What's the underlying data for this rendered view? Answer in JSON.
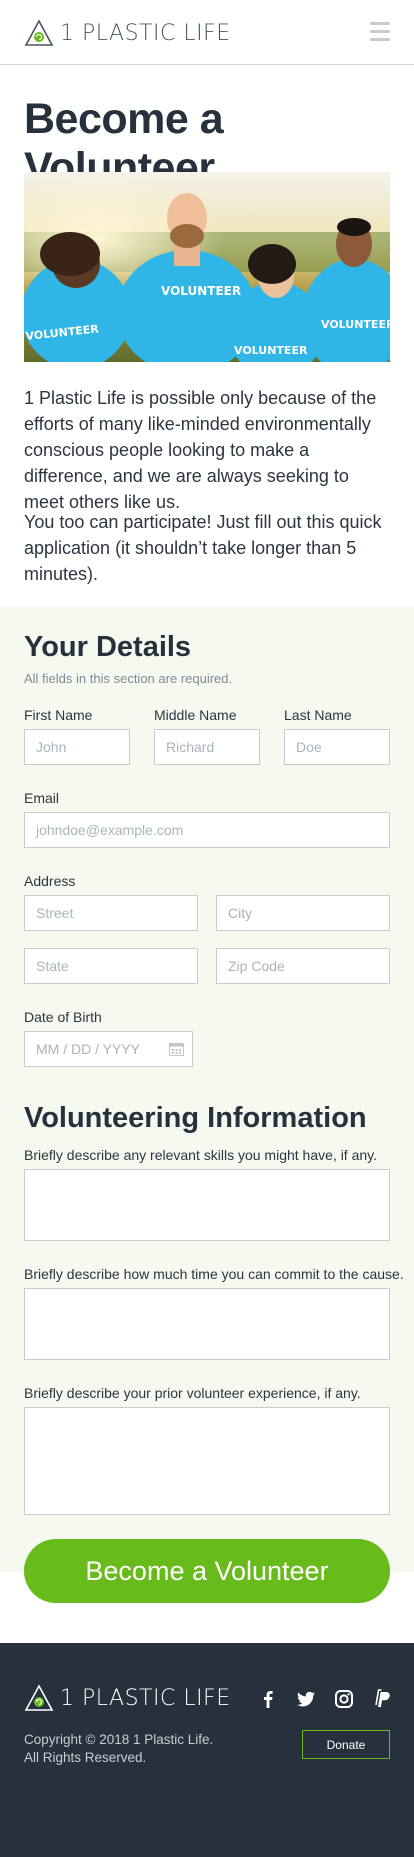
{
  "header": {
    "brand": "1 PLASTIC LIFE",
    "logo_icon": "recycle-triangle-icon",
    "menu_icon": "hamburger-icon"
  },
  "page": {
    "title": "Become a Volunteer"
  },
  "hero": {
    "shirt_text": "VOLUNTEER"
  },
  "intro": {
    "p1": "1 Plastic Life is possible only because of the efforts of many like-minded environmentally conscious people looking to make a difference, and we are always seeking to meet others like us.",
    "p2": "You too can participate! Just fill out this quick application (it shouldn’t take longer than 5 minutes)."
  },
  "details": {
    "title": "Your Details",
    "hint": "All fields in this section are required.",
    "first_name_label": "First Name",
    "first_name_placeholder": "John",
    "middle_name_label": "Middle Name",
    "middle_name_placeholder": "Richard",
    "last_name_label": "Last Name",
    "last_name_placeholder": "Doe",
    "email_label": "Email",
    "email_placeholder": "johndoe@example.com",
    "address_label": "Address",
    "street_placeholder": "Street",
    "city_placeholder": "City",
    "state_placeholder": "State",
    "zip_placeholder": "Zip Code",
    "dob_label": "Date of Birth",
    "dob_placeholder": "MM / DD / YYYY"
  },
  "volunteering": {
    "title": "Volunteering Information",
    "skills_label": "Briefly describe any relevant skills you might have, if any.",
    "time_label": "Briefly describe how much time you can commit to the cause.",
    "experience_label": "Briefly describe your prior volunteer experience, if any."
  },
  "submit_label": "Become a Volunteer",
  "footer": {
    "brand": "1 PLASTIC LIFE",
    "copyright_line1": "Copyright © 2018 1 Plastic Life.",
    "copyright_line2": "All Rights Reserved.",
    "donate_label": "Donate",
    "social_icons": [
      "facebook-icon",
      "twitter-icon",
      "instagram-icon",
      "paypal-icon"
    ]
  },
  "colors": {
    "accent": "#67bb1a",
    "dark": "#27303d",
    "form_bg": "#f6f9ef",
    "shirt": "#2fb5e6"
  }
}
